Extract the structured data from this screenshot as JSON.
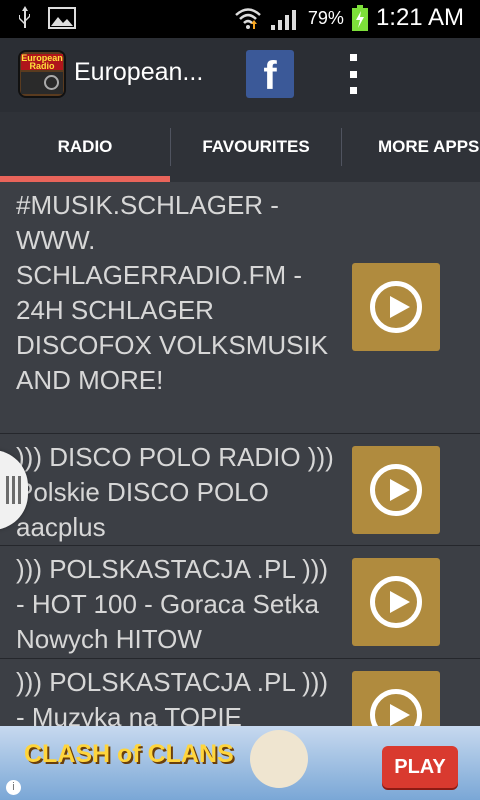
{
  "status_bar": {
    "battery_percent": "79%",
    "time": "1:21 AM"
  },
  "app_bar": {
    "icon_text": "European Radio",
    "title": "European..."
  },
  "facebook": {
    "label": "f"
  },
  "tabs": [
    {
      "label": "RADIO",
      "active": true
    },
    {
      "label": "FAVOURITES"
    },
    {
      "label": "MORE APPS"
    }
  ],
  "stations": [
    {
      "name": "#MUSIK.SCHLAGER - WWW. SCHLAGERRADIO.FM - 24H SCHLAGER DISCOFOX VOLKSMUSIK AND MORE!"
    },
    {
      "name": "))) DISCO POLO RADIO )))  Polskie DISCO POLO  aacplus"
    },
    {
      "name": "))) POLSKASTACJA .PL ))) - HOT 100 - Goraca Setka Nowych HITOW"
    },
    {
      "name": "))) POLSKASTACJA .PL ))) - Muzyka na TOPIE"
    }
  ],
  "ad": {
    "logo": "CLASH of CLANS",
    "play": "PLAY",
    "info": "i"
  }
}
